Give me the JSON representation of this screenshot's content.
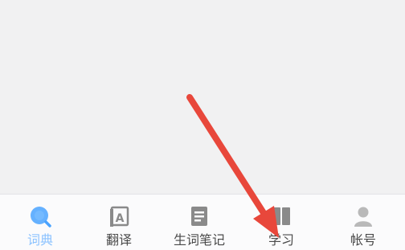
{
  "tabbar": {
    "tabs": [
      {
        "label": "词典",
        "icon": "dictionary-search-icon",
        "active": true
      },
      {
        "label": "翻译",
        "icon": "translate-icon",
        "active": false
      },
      {
        "label": "生词笔记",
        "icon": "notes-icon",
        "active": false
      },
      {
        "label": "学习",
        "icon": "study-book-icon",
        "active": false
      },
      {
        "label": "帐号",
        "icon": "account-icon",
        "active": false
      }
    ]
  },
  "colors": {
    "active": "#4aa3ff",
    "icon_gray": "#8a8a8a",
    "label": "#4a4a4a",
    "arrow": "#e8473b",
    "background": "#f1f1f2",
    "tabbar_bg": "#fbfbfc"
  }
}
